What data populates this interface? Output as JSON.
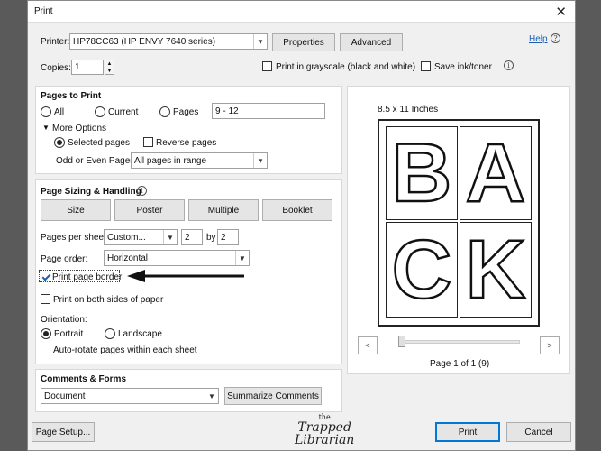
{
  "window": {
    "title": "Print",
    "close_glyph": "✕"
  },
  "printer": {
    "label": "Printer:",
    "selected": "HP78CC63 (HP ENVY 7640 series)",
    "properties_label": "Properties",
    "advanced_label": "Advanced",
    "help_label": "Help"
  },
  "copies": {
    "label": "Copies:",
    "value": "1",
    "grayscale_label": "Print in grayscale (black and white)",
    "grayscale_checked": false,
    "save_ink_label": "Save ink/toner",
    "save_ink_checked": false
  },
  "pages_to_print": {
    "title": "Pages to Print",
    "options": [
      {
        "label": "All",
        "checked": false
      },
      {
        "label": "Current",
        "checked": false
      },
      {
        "label": "Pages",
        "checked": false
      }
    ],
    "pages_value": "9 - 12",
    "more_options_label": "More Options",
    "selected_pages_label": "Selected pages",
    "reverse_pages_label": "Reverse pages",
    "odd_even_label": "Odd or Even Pages:",
    "odd_even_value": "All pages in range"
  },
  "sizing": {
    "title": "Page Sizing & Handling",
    "buttons": [
      "Size",
      "Poster",
      "Multiple",
      "Booklet"
    ],
    "pages_per_sheet_label": "Pages per sheet:",
    "pages_per_sheet_value": "Custom...",
    "cols": "2",
    "by_label": "by",
    "rows": "2",
    "page_order_label": "Page order:",
    "page_order_value": "Horizontal",
    "print_border_label": "Print page border",
    "print_border_checked": true,
    "both_sides_label": "Print on both sides of paper",
    "orientation_label": "Orientation:",
    "portrait_label": "Portrait",
    "landscape_label": "Landscape",
    "auto_rotate_label": "Auto-rotate pages within each sheet"
  },
  "comments": {
    "title": "Comments & Forms",
    "value": "Document",
    "summarize_label": "Summarize Comments"
  },
  "preview": {
    "size_label": "8.5 x 11 Inches",
    "letters": [
      "B",
      "A",
      "C",
      "K"
    ],
    "page_indicator": "Page 1 of 1 (9)",
    "prev_glyph": "<",
    "next_glyph": ">"
  },
  "footer": {
    "page_setup_label": "Page Setup...",
    "print_label": "Print",
    "cancel_label": "Cancel"
  },
  "watermark": {
    "line1": "the",
    "line2": "Trapped",
    "line3": "Librarian"
  },
  "colors": {
    "link": "#1a5fb4",
    "primary_border": "#0078d7",
    "arrow": "#111111"
  }
}
